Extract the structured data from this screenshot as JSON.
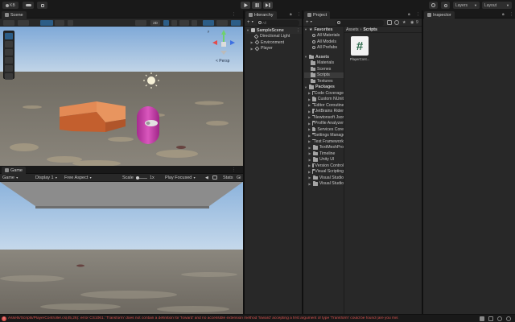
{
  "toolbar": {
    "account_label": "KB",
    "cloud_icon": "cloud-icon",
    "layers_label": "Layers",
    "layout_label": "Layout"
  },
  "scene": {
    "tab_label": "Scene",
    "view_2d_label": "2D",
    "persp_label": "< Persp",
    "gizmo_axis_y": "y",
    "gizmo_axis_x": "x",
    "gizmo_axis_z": "z"
  },
  "game": {
    "tab_label": "Game",
    "mode_label": "Game",
    "display_label": "Display 1",
    "aspect_label": "Free Aspect",
    "scale_label": "Scale",
    "scale_value": "1x",
    "play_focused_label": "Play Focused",
    "stats_label": "Stats",
    "gizmos_label": "Gi"
  },
  "hierarchy": {
    "tab_label": "Hierarchy",
    "add_label": "+",
    "search_placeholder": "All",
    "scene_name": "SampleScene",
    "items": [
      "Directional Light",
      "Environment",
      "Player"
    ]
  },
  "project": {
    "tab_label": "Project",
    "add_label": "+",
    "count_label": "9",
    "favorites_label": "Favorites",
    "favorites": [
      "All Materials",
      "All Models",
      "All Prefabs"
    ],
    "assets_label": "Assets",
    "asset_folders": [
      "Materials",
      "Scenes",
      "Scripts",
      "Textures"
    ],
    "packages_label": "Packages",
    "packages": [
      "Code Coverage",
      "Custom NUnit",
      "Editor Coroutines",
      "JetBrains Rider",
      "Newtonsoft Json",
      "Profile Analyzer",
      "Services Core",
      "Settings Manager",
      "Test Framework",
      "TextMeshPro",
      "Timeline",
      "Unity UI",
      "Version Control",
      "Visual Scripting",
      "Visual Studio",
      "Visual Studio"
    ],
    "breadcrumb_root": "Assets",
    "breadcrumb_sep": "›",
    "breadcrumb_current": "Scripts",
    "file_name": "PlayerCont...",
    "file_glyph": "#"
  },
  "inspector": {
    "tab_label": "Inspector"
  },
  "status": {
    "error_text": "Assets/Scripts/PlayerController.cs(45,26): error CS1061: 'Transform' does not contain a definition for 'foward' and no accessible extension method 'foward' accepting a first argument of type 'Transform' could be found (are you mis"
  },
  "colors": {
    "accent": "#2c5d87",
    "error": "#d9534f",
    "cube": "#d06a3c",
    "capsule": "#c33aa5",
    "sky_top": "#7da8d6",
    "ground": "#6e6a62"
  }
}
